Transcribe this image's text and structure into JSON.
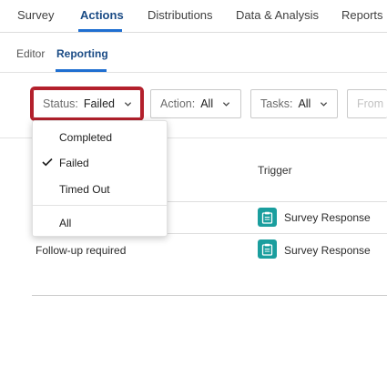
{
  "top_nav": {
    "tabs": [
      {
        "label": "Survey"
      },
      {
        "label": "Actions"
      },
      {
        "label": "Distributions"
      },
      {
        "label": "Data & Analysis"
      },
      {
        "label": "Reports"
      }
    ],
    "active": "Actions"
  },
  "sub_nav": {
    "tabs": [
      {
        "label": "Editor"
      },
      {
        "label": "Reporting"
      }
    ],
    "active": "Reporting"
  },
  "filters": {
    "status": {
      "label": "Status:",
      "value": "Failed"
    },
    "action": {
      "label": "Action:",
      "value": "All"
    },
    "tasks": {
      "label": "Tasks:",
      "value": "All"
    },
    "from": {
      "label": "From"
    }
  },
  "status_dropdown": {
    "options": [
      {
        "label": "Completed",
        "selected": false
      },
      {
        "label": "Failed",
        "selected": true
      },
      {
        "label": "Timed Out",
        "selected": false
      },
      {
        "label": "All",
        "selected": false
      }
    ]
  },
  "table": {
    "headers": {
      "trigger": "Trigger"
    },
    "rows": [
      {
        "action": "",
        "trigger": "Survey Response"
      },
      {
        "action": "Follow-up required",
        "trigger": "Survey Response"
      }
    ]
  },
  "colors": {
    "accent": "#1f6fd1",
    "highlight": "#b3202c",
    "trigger_icon": "#1a9e9e"
  }
}
